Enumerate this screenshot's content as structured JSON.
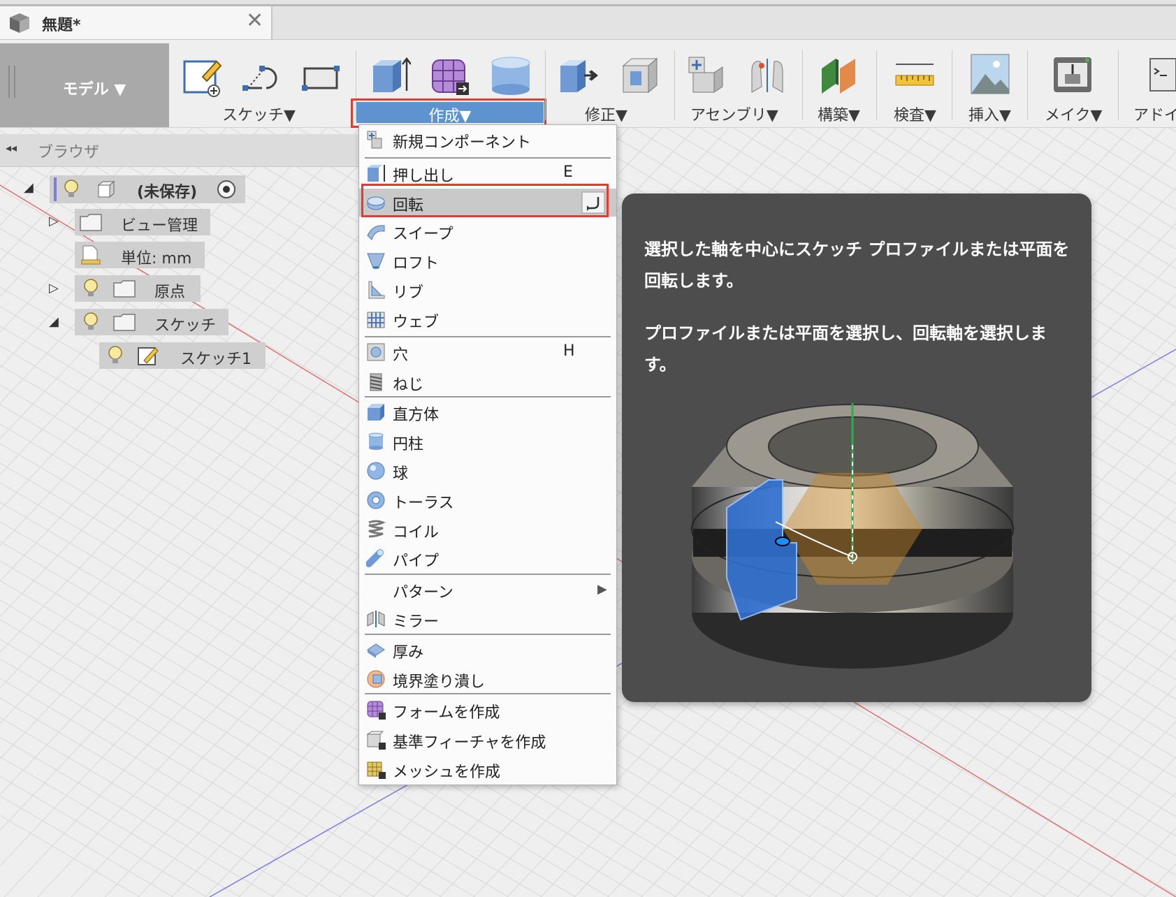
{
  "window": {
    "doc_title": "無題*",
    "close_glyph": "✕"
  },
  "toolbar": {
    "workspace": "モデル ▼",
    "groups": {
      "sketch": "スケッチ▼",
      "create": "作成▼",
      "modify": "修正▼",
      "assemble": "アセンブリ▼",
      "construct": "構築▼",
      "inspect": "検査▼",
      "insert": "挿入▼",
      "make": "メイク▼",
      "addins": "アドイ"
    }
  },
  "browser": {
    "header": "ブラウザ",
    "collapse_glyph": "◂◂",
    "root": "(未保存)",
    "nodes": {
      "views": "ビュー管理",
      "units": "単位: mm",
      "origin": "原点",
      "sketches": "スケッチ",
      "sketch1": "スケッチ1"
    }
  },
  "menu": {
    "items": [
      {
        "label": "新規コンポーネント",
        "shortcut": ""
      },
      {
        "label": "押し出し",
        "shortcut": "E"
      },
      {
        "label": "回転",
        "shortcut": ""
      },
      {
        "label": "スイープ",
        "shortcut": ""
      },
      {
        "label": "ロフト",
        "shortcut": ""
      },
      {
        "label": "リブ",
        "shortcut": ""
      },
      {
        "label": "ウェブ",
        "shortcut": ""
      },
      {
        "label": "穴",
        "shortcut": "H"
      },
      {
        "label": "ねじ",
        "shortcut": ""
      },
      {
        "label": "直方体",
        "shortcut": ""
      },
      {
        "label": "円柱",
        "shortcut": ""
      },
      {
        "label": "球",
        "shortcut": ""
      },
      {
        "label": "トーラス",
        "shortcut": ""
      },
      {
        "label": "コイル",
        "shortcut": ""
      },
      {
        "label": "パイプ",
        "shortcut": ""
      },
      {
        "label": "パターン",
        "shortcut": "▶"
      },
      {
        "label": "ミラー",
        "shortcut": ""
      },
      {
        "label": "厚み",
        "shortcut": ""
      },
      {
        "label": "境界塗り潰し",
        "shortcut": ""
      },
      {
        "label": "フォームを作成",
        "shortcut": ""
      },
      {
        "label": "基準フィーチャを作成",
        "shortcut": ""
      },
      {
        "label": "メッシュを作成",
        "shortcut": ""
      }
    ]
  },
  "tooltip": {
    "description": "選択した軸を中心にスケッチ プロファイルまたは平面を回転します。",
    "instruction": "プロファイルまたは平面を選択し、回転軸を選択します。"
  },
  "colors": {
    "highlight_red": "#e43a2f",
    "create_blue": "#5d93cf",
    "tooltip_bg": "#4d4d4d",
    "workspace_bg": "#a9a9a9"
  }
}
